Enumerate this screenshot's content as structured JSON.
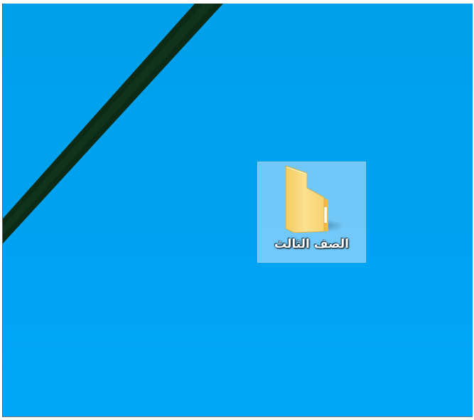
{
  "desktop": {
    "background_color": "#00a2f0",
    "background_color_top": "#00a0ea",
    "background_color_bottom": "#02a8f8",
    "stripe_color": "#0c2a16"
  },
  "icons": [
    {
      "label": "الصف الثالث",
      "icon": "folder-icon",
      "selected": true,
      "selection_fill": "#cde8ff",
      "folder_color": "#f8d775"
    }
  ]
}
